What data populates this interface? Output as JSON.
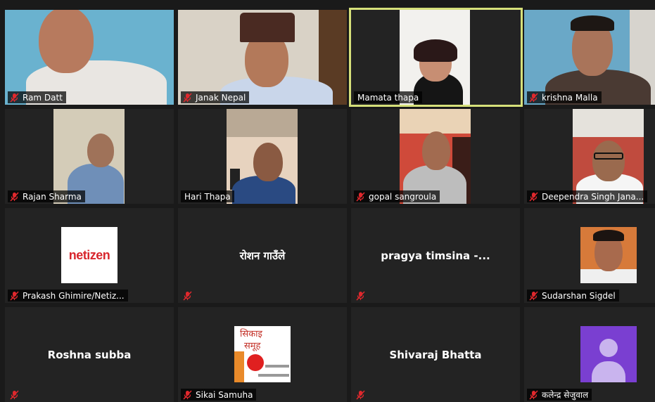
{
  "participants": [
    {
      "name": "Ram Datt",
      "muted": true
    },
    {
      "name": "Janak Nepal",
      "muted": true
    },
    {
      "name": "Mamata thapa",
      "muted": false,
      "active_speaker": true
    },
    {
      "name": "krishna Malla",
      "muted": true
    },
    {
      "name": "Rajan Sharma",
      "muted": true
    },
    {
      "name": "Hari Thapa",
      "muted": false
    },
    {
      "name": "gopal sangroula",
      "muted": true
    },
    {
      "name": "Deependra Singh Jana...",
      "muted": true
    },
    {
      "name": "Prakash Ghimire/Netiz...",
      "muted": true,
      "logo_text": "netizen"
    },
    {
      "name": "रोशन गाउँले",
      "muted": true,
      "video_off": true
    },
    {
      "name": "pragya timsina -...",
      "muted": true,
      "video_off": true
    },
    {
      "name": "Sudarshan Sigdel",
      "muted": true
    },
    {
      "name": "Roshna subba",
      "muted": true,
      "video_off": true
    },
    {
      "name": "Sikai Samuha",
      "muted": true,
      "logo_text": [
        "सिकाइ",
        "समूह"
      ]
    },
    {
      "name": "Shivaraj Bhatta",
      "muted": true,
      "video_off": true
    },
    {
      "name": "कलेन्द्र सेजुवाल",
      "muted": true,
      "avatar": "default-avatar"
    }
  ],
  "colors": {
    "background": "#1a1a1a",
    "tile": "#232323",
    "active_border": "#d6e07a",
    "mute_icon": "#e0282d",
    "avatar_bg": "#7a3fd1"
  }
}
